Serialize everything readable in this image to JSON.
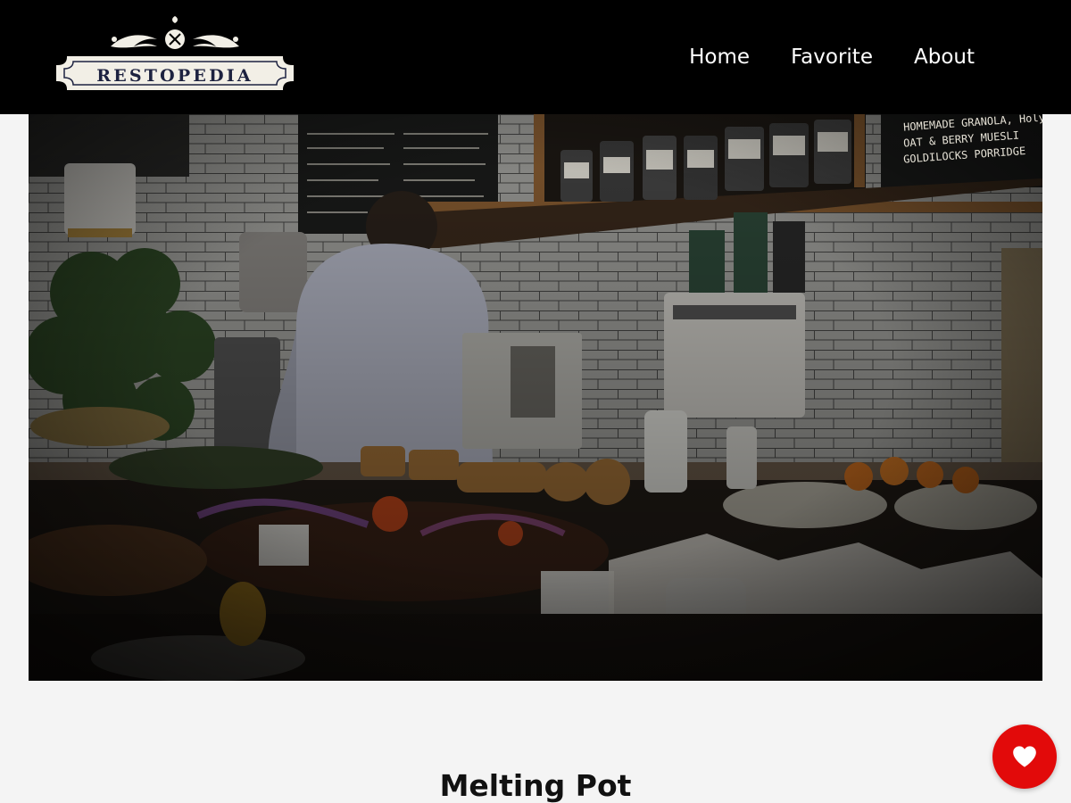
{
  "brand": {
    "name": "RESTOPEDIA"
  },
  "nav": {
    "items": [
      {
        "label": "Home"
      },
      {
        "label": "Favorite"
      },
      {
        "label": "About"
      }
    ]
  },
  "hero": {
    "chalkboard_right": [
      "HOMEMADE GRANOLA, Holy",
      "OAT & BERRY MUESLI",
      "GOLDILOCKS PORRIDGE"
    ]
  },
  "restaurant": {
    "name": "Melting Pot"
  },
  "favorite_button": {
    "icon": "heart-icon",
    "color": "#e20a0a"
  },
  "colors": {
    "navbar": "#000000",
    "background": "#f4f4f4",
    "logo_text": "#1d2240"
  }
}
